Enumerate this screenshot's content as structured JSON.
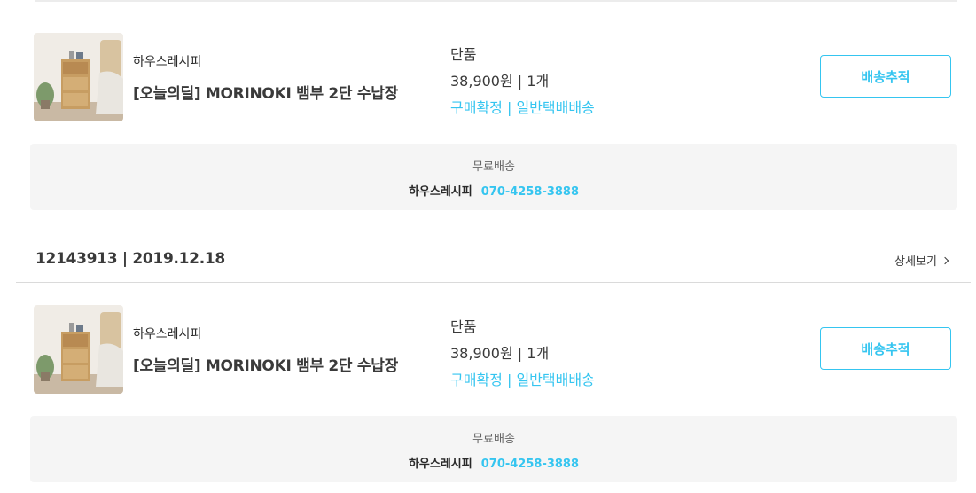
{
  "colors": {
    "accent": "#35c5f0",
    "box_bg": "#f5f5f5",
    "text": "#292929"
  },
  "order": {
    "title": "12143913 | 2019.12.18",
    "detail_link": "상세보기"
  },
  "items": [
    {
      "seller": "하우스레시피",
      "product": "[오늘의딜] MORINOKI 뱀부 2단 수납장",
      "option": "단품",
      "price": "38,900원 | 1개",
      "status": "구매확정 | 일반택배배송",
      "button": "배송추적",
      "shipping": {
        "type": "무료배송",
        "seller": "하우스레시피",
        "phone": "070-4258-3888"
      }
    },
    {
      "seller": "하우스레시피",
      "product": "[오늘의딜] MORINOKI 뱀부 2단 수납장",
      "option": "단품",
      "price": "38,900원 | 1개",
      "status": "구매확정 | 일반택배배송",
      "button": "배송추적",
      "shipping": {
        "type": "무료배송",
        "seller": "하우스레시피",
        "phone": "070-4258-3888"
      }
    }
  ]
}
